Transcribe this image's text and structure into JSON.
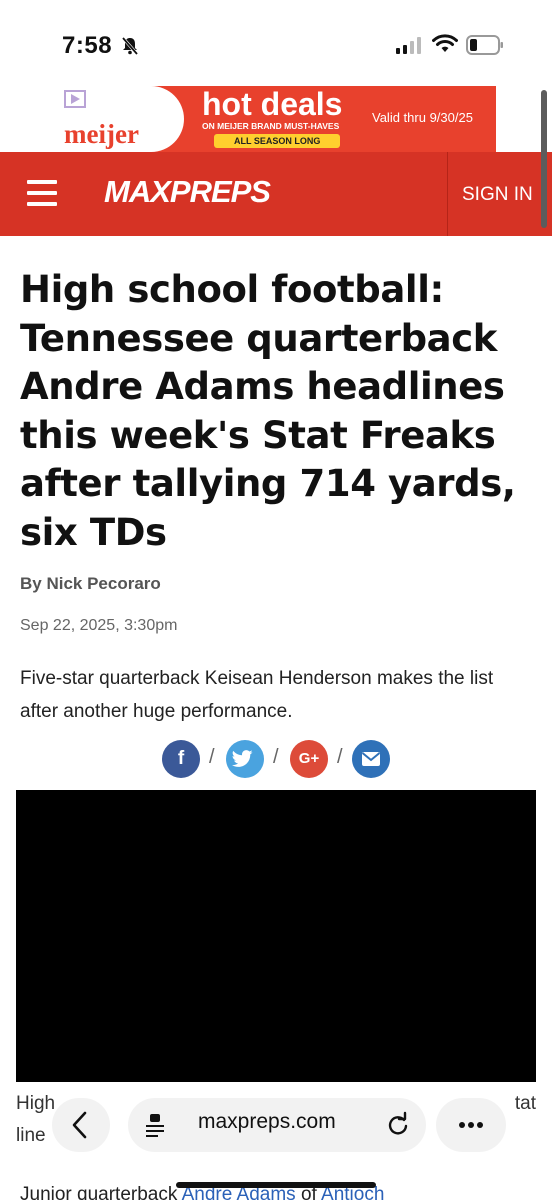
{
  "status_bar": {
    "time": "7:58"
  },
  "ad": {
    "brand": "meijer",
    "headline": "hot deals",
    "subline": "ON MEIJER BRAND MUST-HAVES",
    "pill": "ALL SEASON LONG",
    "valid": "Valid thru 9/30/25"
  },
  "header": {
    "logo": "MAXPREPS",
    "sign_in": "SIGN IN"
  },
  "article": {
    "title": "High school football: Tennessee quarterback Andre Adams headlines this week's Stat Freaks after tallying 714 yards, six TDs",
    "byline": "By Nick Pecoraro",
    "date": "Sep 22, 2025, 3:30pm",
    "dek": "Five-star quarterback Keisean Henderson makes the list after another huge performance.",
    "caption_line1": "High",
    "caption_line1_end": "tat",
    "caption_line2": "line",
    "body_start": "Junior quarterback ",
    "body_link1": "Andre Adams",
    "body_mid": " of ",
    "body_link2": "Antioch"
  },
  "share": {
    "facebook": "f",
    "google": "G+",
    "separator": "/"
  },
  "browser": {
    "url": "maxpreps.com"
  }
}
